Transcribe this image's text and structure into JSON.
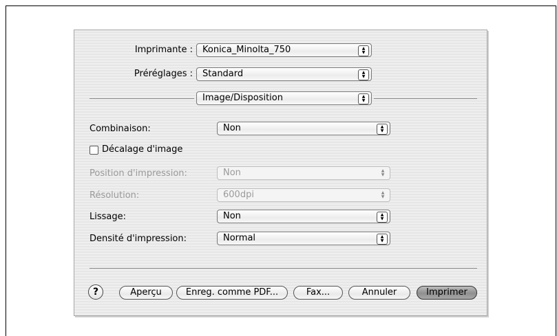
{
  "header": {
    "printer_label": "Imprimante :",
    "printer_value": "Konica_Minolta_750",
    "presets_label": "Préréglages :",
    "presets_value": "Standard",
    "panel_value": "Image/Disposition"
  },
  "settings": {
    "combinaison_label": "Combinaison:",
    "combinaison_value": "Non",
    "offset_checkbox_label": "Décalage d'image",
    "position_label": "Position d'impression:",
    "position_value": "Non",
    "resolution_label": "Résolution:",
    "resolution_value": "600dpi",
    "smoothing_label": "Lissage:",
    "smoothing_value": "Non",
    "density_label": "Densité d'impression:",
    "density_value": "Normal"
  },
  "footer": {
    "help_label": "?",
    "preview_label": "Aperçu",
    "save_pdf_label": "Enreg. comme PDF...",
    "fax_label": "Fax...",
    "cancel_label": "Annuler",
    "print_label": "Imprimer"
  }
}
